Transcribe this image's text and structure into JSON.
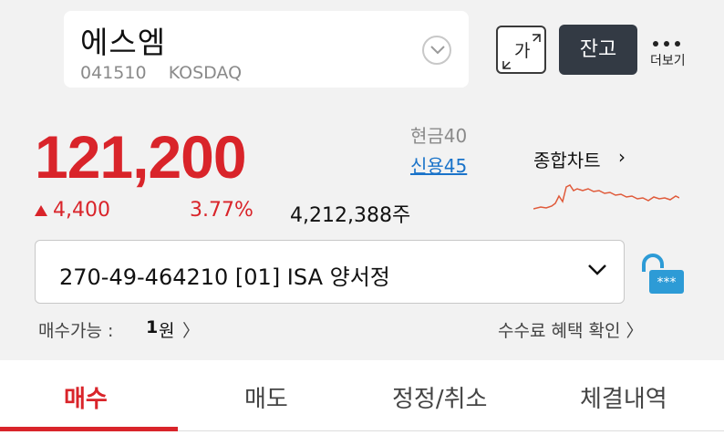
{
  "header": {
    "stock_name": "에스엠",
    "stock_code": "041510",
    "market": "KOSDAQ",
    "font_size_label": "가",
    "balance_label": "잔고",
    "more_label": "더보기"
  },
  "quote": {
    "price": "121,200",
    "margin_cash": "현금40",
    "margin_credit": "신용45",
    "chart_link": "종합차트",
    "change_amount": "4,400",
    "change_rate": "3.77%",
    "volume": "4,212,388주",
    "direction": "up",
    "up_color": "#d9242a"
  },
  "account": {
    "selected": "270-49-464210  [01] ISA 양서정"
  },
  "buying_power": {
    "label": "매수가능 :",
    "value": "1",
    "unit": "원",
    "chevron": "〉"
  },
  "fee_link": "수수료 혜택 확인 〉",
  "tabs": [
    {
      "label": "매수",
      "active": true
    },
    {
      "label": "매도",
      "active": false
    },
    {
      "label": "정정/취소",
      "active": false
    },
    {
      "label": "체결내역",
      "active": false
    }
  ],
  "icons": {
    "dropdown": "chevron-down-icon",
    "font_size": "font-size-icon",
    "more": "more-dots-icon",
    "chart": "chevron-right-icon",
    "lock": "keypad-lock-icon"
  }
}
